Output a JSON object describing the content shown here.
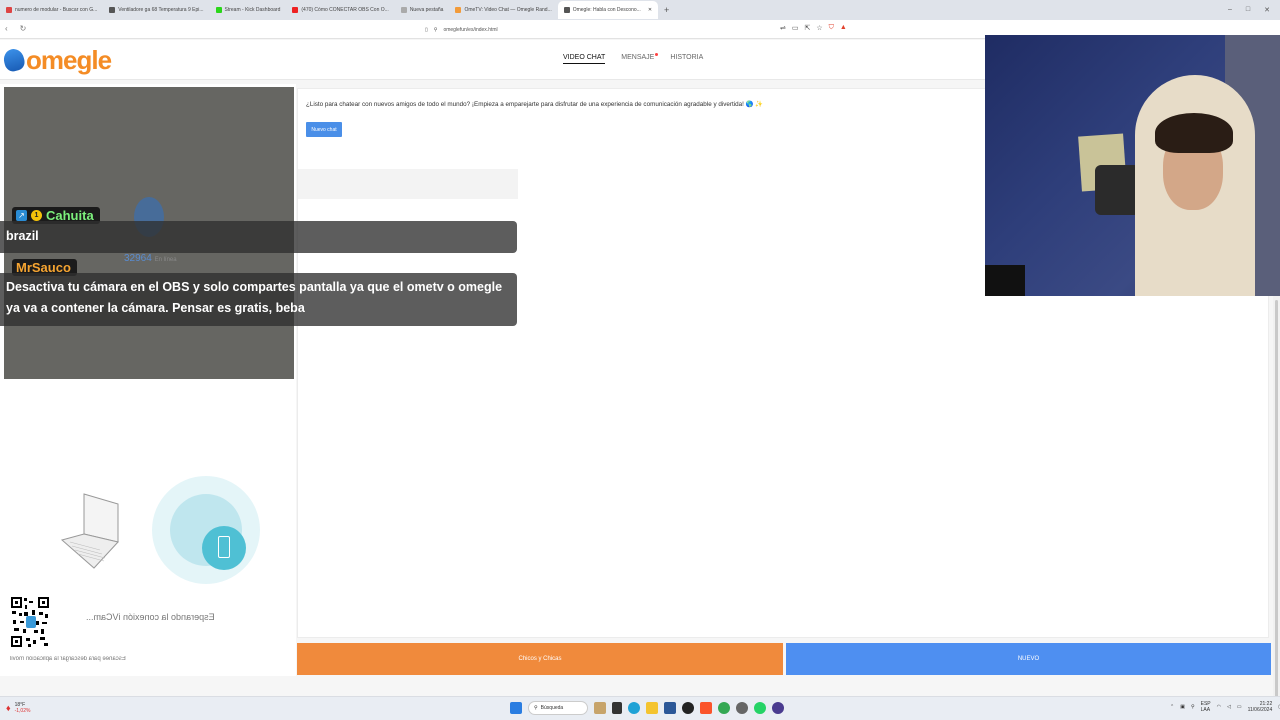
{
  "browser": {
    "tabs": [
      {
        "label": "numero de modular - Buscar con G...",
        "color": "#d44"
      },
      {
        "label": "Ventiladore ga 68 Temperatura 9 Epi...",
        "color": "#555"
      },
      {
        "label": "Stream - Kick Dashboard",
        "color": "#2bd61a"
      },
      {
        "label": "(470) Cómo CONECTAR OBS Con O...",
        "color": "#e22"
      },
      {
        "label": "Nueva pestaña",
        "color": "#aaa"
      },
      {
        "label": "OmeTV: Video Chat — Omegle Rand...",
        "color": "#f29b3a"
      },
      {
        "label": "Omegle: Habla con Descono...",
        "color": "#555",
        "active": true
      }
    ],
    "new_tab": "+",
    "window_controls": [
      "–",
      "□",
      "✕"
    ],
    "url": "omeglefun/es/index.html"
  },
  "site": {
    "logo": "omegle",
    "nav": [
      {
        "label": "VIDEO CHAT",
        "active": true
      },
      {
        "label": "MENSAJE",
        "dot": true
      },
      {
        "label": "HISTORIA"
      }
    ]
  },
  "video": {
    "online_count": "32964",
    "online_suffix": "En línea"
  },
  "app_promo": {
    "waiting_text": "Esperando la conexión iVCam...",
    "qr_caption": "Escanee para descargar la aplicación móvil"
  },
  "chat": {
    "intro": "¿Listo para chatear con nuevos amigos de todo el mundo? ¡Empieza a emparejarte para disfrutar de una experiencia de comunicación agradable y divertida! 🌎 ✨",
    "new_chat_button": "Nuevo chat"
  },
  "buttons": {
    "left": "Chicos y Chicas",
    "right": "NUEVO"
  },
  "stream_chat": [
    {
      "user": "Cahuita",
      "badge_num": "1",
      "name_color": "#7cf07c",
      "message": "brazil"
    },
    {
      "user": "MrSauco",
      "name_color": "#f5a431",
      "message": "Desactiva tu cámara en el OBS y solo compartes pantalla ya que el ometv o omegle ya va a contener la cámara. Pensar es gratis, beba"
    }
  ],
  "taskbar": {
    "weather_temp": "18°F",
    "weather_sub": "-1,02%",
    "search_label": "Búsqueda",
    "lang": "ESP",
    "lang_sub": "LAA",
    "time": "21:22",
    "date": "11/06/2024"
  }
}
